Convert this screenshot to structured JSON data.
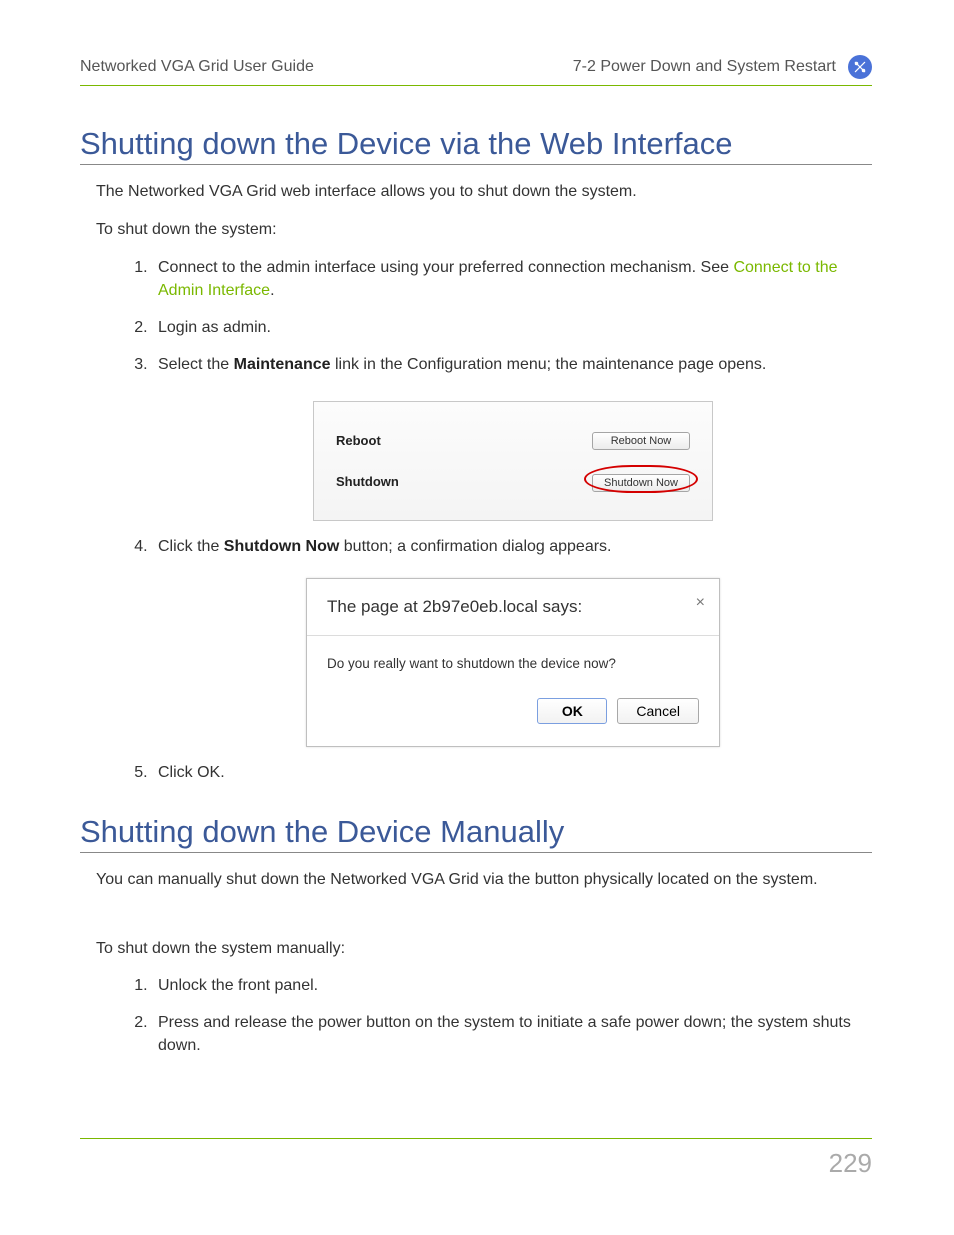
{
  "header": {
    "left": "Networked VGA Grid User Guide",
    "right": "7-2 Power Down and System Restart"
  },
  "section1": {
    "title": "Shutting down the Device via the Web Interface",
    "intro": "The Networked VGA Grid web interface allows you to shut down the system.",
    "lead": "To shut down the system:",
    "step1_a": "Connect to the admin interface using your preferred connection mechanism. See ",
    "step1_link": "Connect to the Admin Interface",
    "step1_b": ".",
    "step2": "Login as admin.",
    "step3_a": "Select the ",
    "step3_bold": "Maintenance",
    "step3_b": " link in the Configuration menu; the maintenance page opens.",
    "panel": {
      "reboot_label": "Reboot",
      "reboot_btn": "Reboot Now",
      "shutdown_label": "Shutdown",
      "shutdown_btn": "Shutdown Now"
    },
    "step4_a": "Click the ",
    "step4_bold": "Shutdown Now",
    "step4_b": "  button; a confirmation dialog appears.",
    "dialog": {
      "title": "The page at 2b97e0eb.local says:",
      "close": "×",
      "message": "Do you really want to shutdown the device now?",
      "ok": "OK",
      "cancel": "Cancel"
    },
    "step5": "Click OK."
  },
  "section2": {
    "title": "Shutting down the Device Manually",
    "intro": "You can manually shut down the Networked VGA Grid via the button physically located on the system.",
    "lead": "To shut down the system manually:",
    "step1": "Unlock the front panel.",
    "step2": "Press and release the power button on the system to initiate a safe power down; the system shuts down."
  },
  "page_number": "229"
}
